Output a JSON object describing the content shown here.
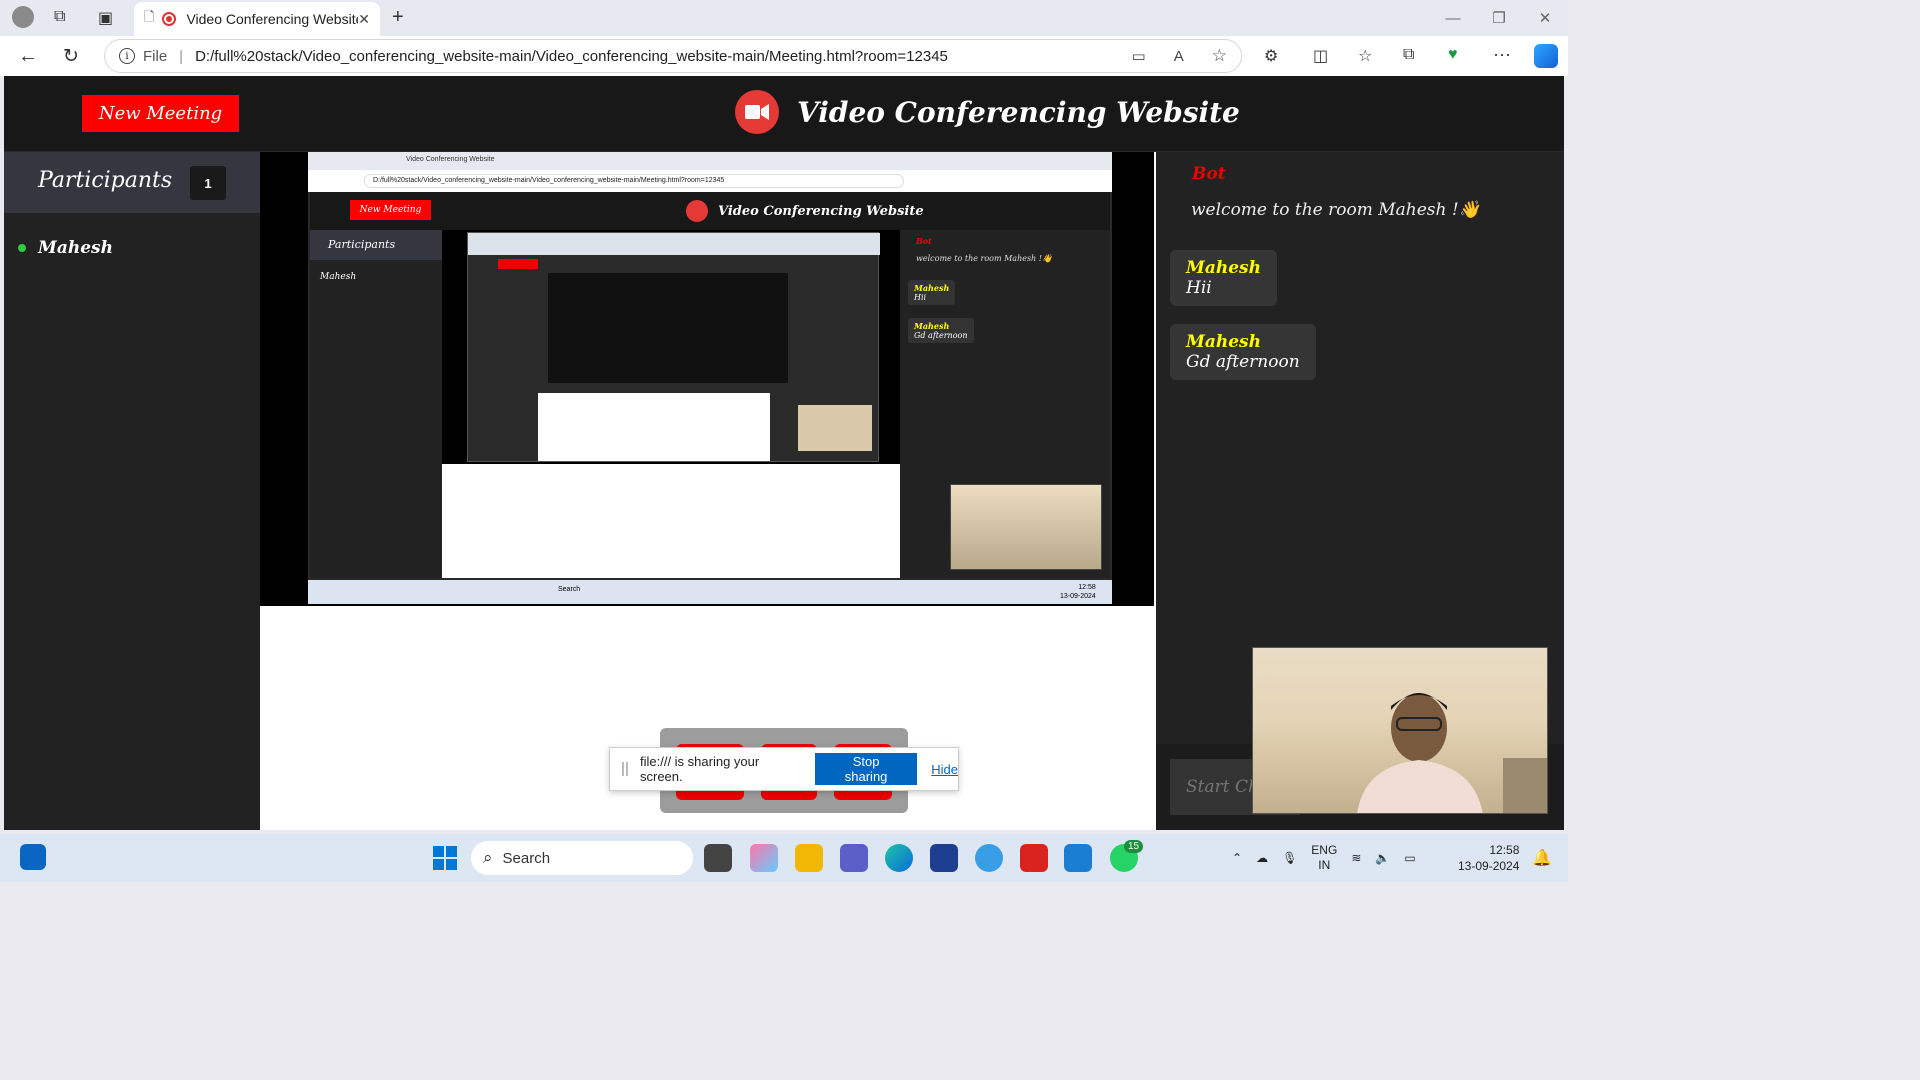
{
  "browser": {
    "tab_title": "Video Conferencing Website",
    "address_prefix": "File",
    "url": "D:/full%20stack/Video_conferencing_website-main/Video_conferencing_website-main/Meeting.html?room=12345"
  },
  "app": {
    "new_meeting_label": "New Meeting",
    "title": "Video Conferencing Website",
    "participants_title": "Participants",
    "participants_count": "1",
    "participants": [
      {
        "name": "Mahesh",
        "status_color": "#2ecc40"
      }
    ],
    "chat": {
      "bot_label": "Bot",
      "welcome_message": "welcome to the room Mahesh !👋",
      "messages": [
        {
          "sender": "Mahesh",
          "text": "Hii"
        },
        {
          "sender": "Mahesh",
          "text": "Gd afternoon"
        }
      ],
      "input_placeholder": "Start Ch"
    },
    "accent_color": "#ff0000",
    "sender_color": "#ffff00"
  },
  "share_notice": {
    "text": "file:/// is sharing your screen.",
    "stop_label": "Stop sharing",
    "hide_label": "Hide"
  },
  "taskbar": {
    "search_label": "Search",
    "lang_top": "ENG",
    "lang_bottom": "IN",
    "time": "12:58",
    "date": "13-09-2024",
    "whatsapp_badge": "15"
  }
}
